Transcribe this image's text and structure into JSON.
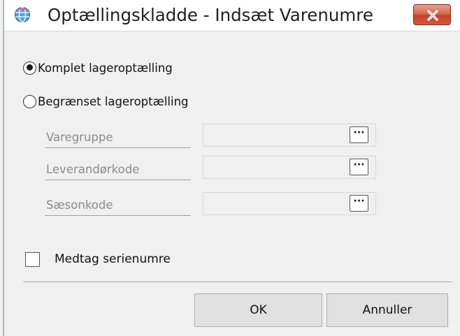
{
  "window": {
    "title": "Optællingskladde - Indsæt Varenumre",
    "icon": "app-globe-icon",
    "close_icon": "close-icon"
  },
  "options": {
    "complete_label": "Komplet lageroptælling",
    "complete_selected": true,
    "limited_label": "Begrænset lageroptælling",
    "limited_selected": false
  },
  "fields": [
    {
      "label": "Varegruppe",
      "value": "",
      "lookup_label": "···"
    },
    {
      "label": "Leverandørkode",
      "value": "",
      "lookup_label": "···"
    },
    {
      "label": "Sæsonkode",
      "value": "",
      "lookup_label": "···"
    }
  ],
  "include_serials": {
    "label": "Medtag serienumre",
    "checked": false
  },
  "buttons": {
    "ok_label": "OK",
    "cancel_label": "Annuller"
  },
  "colors": {
    "close_button": "#c4422a",
    "dialog_background": "#f0f0f0",
    "disabled_text": "#8a8a8a"
  }
}
